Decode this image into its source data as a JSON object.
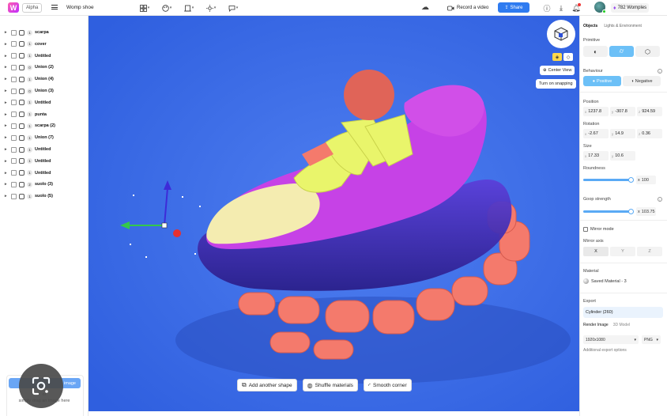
{
  "topbar": {
    "logo_letter": "W",
    "alpha_badge": "Alpha",
    "project_name": "Womp shoe",
    "record_label": "Record a video",
    "share_label": "Share",
    "womples_label": "782 Womples"
  },
  "sidebar": {
    "items": [
      {
        "count": "1",
        "label": "scarpa"
      },
      {
        "count": "1",
        "label": "cover"
      },
      {
        "count": "1",
        "label": "Untitled"
      },
      {
        "count": "0",
        "label": "Union (2)"
      },
      {
        "count": "1",
        "label": "Union (4)"
      },
      {
        "count": "0",
        "label": "Union (3)"
      },
      {
        "count": "1",
        "label": "Untitled"
      },
      {
        "count": "1",
        "label": "punta"
      },
      {
        "count": "1",
        "label": "scarpa (2)"
      },
      {
        "count": "1",
        "label": "Union (7)"
      },
      {
        "count": "1",
        "label": "Untitled"
      },
      {
        "count": "1",
        "label": "Untitled"
      },
      {
        "count": "1",
        "label": "Untitled"
      },
      {
        "count": "2",
        "label": "suolo (3)"
      },
      {
        "count": "1",
        "label": "suolo (5)"
      }
    ],
    "upload_label": "image",
    "or_label": "or",
    "drag_label": "simply drag an image here"
  },
  "canvas": {
    "center_view_label": "Center View",
    "snapping_label": "Turn on snapping",
    "bottom_tools": [
      {
        "icon": "add-shape-icon",
        "label": "Add another shape"
      },
      {
        "icon": "shuffle-icon",
        "label": "Shuffle materials"
      },
      {
        "icon": "corner-icon",
        "label": "Smooth corner"
      }
    ],
    "colors": {
      "background": "#3b6be8",
      "sole": "#f47a6c",
      "upper": "#c642e6",
      "strap": "#e9f56b",
      "toe": "#f4ecb0",
      "heel_ball": "#e06458"
    }
  },
  "panel": {
    "tabs": [
      "Objects",
      "Lights & Environment"
    ],
    "primitive_label": "Primitive",
    "behaviour_label": "Behaviour",
    "positive_label": "Positive",
    "negative_label": "Negative",
    "position_label": "Position",
    "position": {
      "x": "1237.8",
      "y": "-307.8",
      "z": "924.59"
    },
    "rotation_label": "Rotation",
    "rotation": {
      "x": "-2.67",
      "y": "14.9",
      "z": "0.36"
    },
    "size_label": "Size",
    "size": {
      "x": "17.33",
      "y": "10.6"
    },
    "roundness_label": "Roundness",
    "roundness_value": "100",
    "roundness_fraction": 0.95,
    "goop_label": "Goop strength",
    "goop_value": "103.75",
    "goop_fraction": 0.95,
    "mirror_label": "Mirror mode",
    "mirror_axis_label": "Mirror axis",
    "mirror_axes": [
      "X",
      "Y",
      "Z"
    ],
    "material_label": "Material",
    "material_name": "Saved Material - 3",
    "export_label": "Export",
    "export_object": "Cylinder (260)",
    "export_tabs": [
      "Render Image",
      "3D Model"
    ],
    "resolution": "1920x1080",
    "format": "PNG",
    "more_export": "Additional export options"
  }
}
